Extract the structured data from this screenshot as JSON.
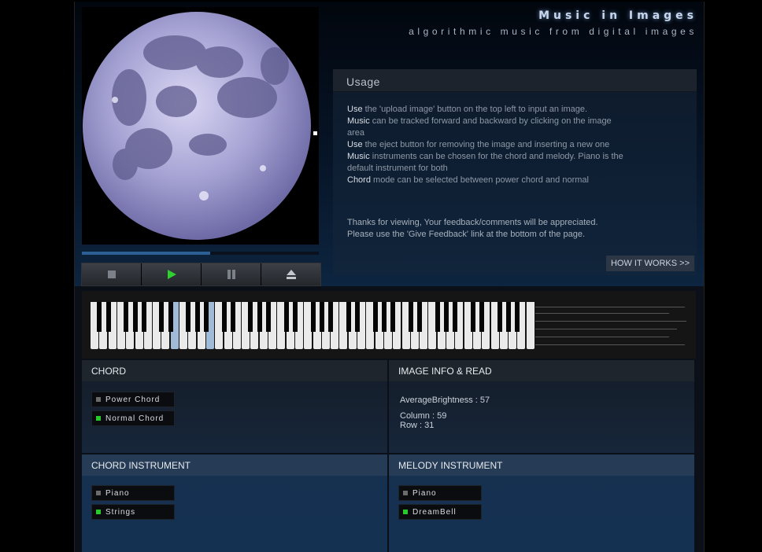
{
  "header": {
    "title": "Music in Images",
    "subtitle": "algorithmic music from digital images"
  },
  "player": {
    "progress": 0.54,
    "buttons": [
      "stop",
      "play",
      "pause",
      "eject"
    ],
    "colors": {
      "play": "#2fd12f",
      "icon": "#7c8088"
    }
  },
  "usage": {
    "title": "Usage",
    "lines": [
      {
        "lead": "Use",
        "rest": " the 'upload image' button on the top left to input an image."
      },
      {
        "lead": "Music",
        "rest": " can be tracked forward and backward by clicking on the image area"
      },
      {
        "lead": "Use",
        "rest": " the eject button for removing the image and inserting a new one"
      },
      {
        "lead": "Music",
        "rest": " instruments can be chosen for the chord and melody. Piano is the default instrument for both"
      },
      {
        "lead": "Chord",
        "rest": " mode can be selected between power chord and normal"
      }
    ],
    "thanks": [
      "Thanks for viewing, Your feedback/comments will be appreciated.",
      "Please use the 'Give Feedback' link at the bottom of the page."
    ],
    "link": "HOW IT WORKS >>"
  },
  "keyboard": {
    "active_white_keys": [
      9,
      13
    ]
  },
  "chord": {
    "title": "CHORD",
    "options": [
      {
        "label": "Power Chord",
        "selected": false
      },
      {
        "label": "Normal Chord",
        "selected": true
      }
    ]
  },
  "image_info": {
    "title": "IMAGE INFO & READ",
    "brightness": "AverageBrightness : 57",
    "column": "Column : 59",
    "row": "Row  : 31"
  },
  "chord_instrument": {
    "title": "CHORD INSTRUMENT",
    "options": [
      {
        "label": "Piano",
        "selected": false
      },
      {
        "label": "Strings",
        "selected": true
      }
    ]
  },
  "melody_instrument": {
    "title": "MELODY INSTRUMENT",
    "options": [
      {
        "label": "Piano",
        "selected": false
      },
      {
        "label": "DreamBell",
        "selected": true
      }
    ]
  }
}
